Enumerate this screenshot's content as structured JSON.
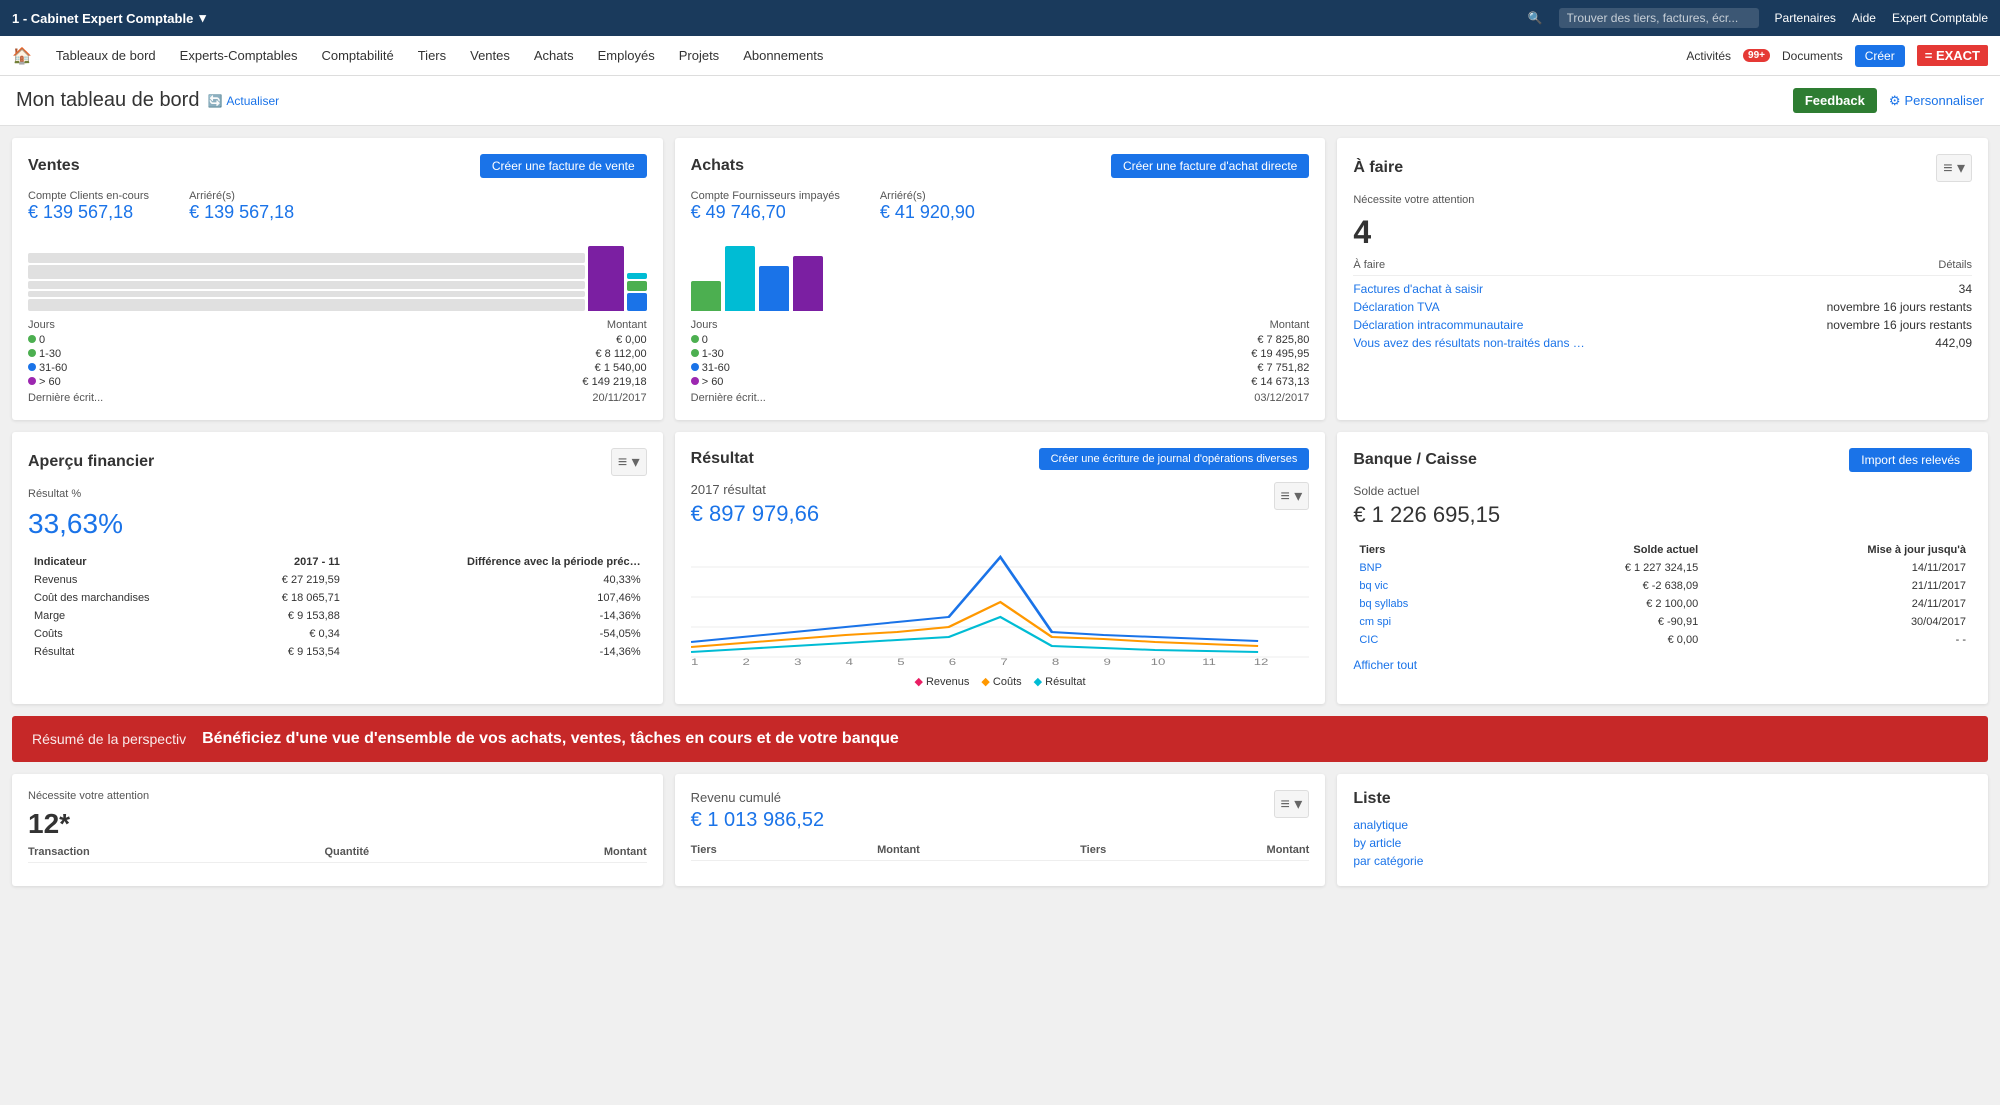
{
  "topbar": {
    "company": "1 - Cabinet Expert Comptable",
    "search_placeholder": "Trouver des tiers, factures, écr...",
    "partenaires": "Partenaires",
    "aide": "Aide",
    "expert_comptable": "Expert Comptable"
  },
  "navbar": {
    "items": [
      "Tableaux de bord",
      "Experts-Comptables",
      "Comptabilité",
      "Tiers",
      "Ventes",
      "Achats",
      "Employés",
      "Projets",
      "Abonnements"
    ],
    "activites": "Activités",
    "badge": "99+",
    "documents": "Documents",
    "creer": "Créer",
    "logo": "= EXACT"
  },
  "page": {
    "title": "Mon tableau de bord",
    "actualiser": "Actualiser",
    "feedback": "Feedback",
    "personaliser": "Personnaliser"
  },
  "ventes": {
    "title": "Ventes",
    "btn": "Créer une facture de vente",
    "compte_label": "Compte Clients en-cours",
    "compte_value": "€ 139 567,18",
    "arriere_label": "Arriéré(s)",
    "arriere_value": "€ 139 567,18",
    "legend": {
      "headers": [
        "Jours",
        "Montant"
      ],
      "rows": [
        {
          "dot_color": "#4caf50",
          "jours": "0",
          "montant": "€ 0,00"
        },
        {
          "dot_color": "#4caf50",
          "jours": "1-30",
          "montant": "€ 8 112,00"
        },
        {
          "dot_color": "#1a73e8",
          "jours": "31-60",
          "montant": "€ 1 540,00"
        },
        {
          "dot_color": "#9c27b0",
          "jours": "> 60",
          "montant": "€ 149 219,18"
        }
      ],
      "derniere": "Dernière écrit...",
      "derniere_val": "20/11/2017"
    }
  },
  "achats": {
    "title": "Achats",
    "btn": "Créer une facture d'achat directe",
    "compte_label": "Compte Fournisseurs impayés",
    "compte_value": "€ 49 746,70",
    "arriere_label": "Arriéré(s)",
    "arriere_value": "€ 41 920,90",
    "legend": {
      "headers": [
        "Jours",
        "Montant"
      ],
      "rows": [
        {
          "dot_color": "#4caf50",
          "jours": "0",
          "montant": "€ 7 825,80"
        },
        {
          "dot_color": "#4caf50",
          "jours": "1-30",
          "montant": "€ 19 495,95"
        },
        {
          "dot_color": "#1a73e8",
          "jours": "31-60",
          "montant": "€ 7 751,82"
        },
        {
          "dot_color": "#9c27b0",
          "jours": "> 60",
          "montant": "€ 14 673,13"
        }
      ],
      "derniere": "Dernière écrit...",
      "derniere_val": "03/12/2017"
    }
  },
  "afaire": {
    "title": "À faire",
    "attention_label": "Nécessite votre attention",
    "number": "4",
    "col1": "À faire",
    "col2": "Détails",
    "rows": [
      {
        "label": "Factures d'achat à saisir",
        "detail": "34",
        "detail_type": "number"
      },
      {
        "label": "Déclaration TVA",
        "detail": "novembre 16 jours restants",
        "detail_type": "text"
      },
      {
        "label": "Déclaration intracommunautaire",
        "detail": "novembre 16 jours restants",
        "detail_type": "text"
      },
      {
        "label": "Vous avez des résultats non-traités dans …",
        "detail": "442,09",
        "detail_type": "number"
      }
    ]
  },
  "apercu": {
    "title": "Aperçu financier",
    "resultat_label": "Résultat %",
    "resultat_value": "33,63%",
    "table_headers": [
      "Indicateur",
      "2017 - 11",
      "Différence avec la période préc…"
    ],
    "rows": [
      {
        "label": "Revenus",
        "val1": "€ 27 219,59",
        "val2": "40,33%"
      },
      {
        "label": "Coût des marchandises",
        "val1": "€ 18 065,71",
        "val2": "107,46%"
      },
      {
        "label": "Marge",
        "val1": "€ 9 153,88",
        "val2": "-14,36%"
      },
      {
        "label": "Coûts",
        "val1": "€ 0,34",
        "val2": "-54,05%"
      },
      {
        "label": "Résultat",
        "val1": "€ 9 153,54",
        "val2": "-14,36%"
      }
    ]
  },
  "resultat": {
    "title": "Résultat",
    "btn": "Créer une écriture de journal d'opérations diverses",
    "year_label": "2017 résultat",
    "value": "€ 897 979,66",
    "legend": {
      "revenus": "Revenus",
      "couts": "Coûts",
      "resultat": "Résultat"
    },
    "chart": {
      "labels": [
        "1",
        "2",
        "3",
        "4",
        "5",
        "6",
        "7",
        "8",
        "9",
        "10",
        "11",
        "12"
      ],
      "revenus": [
        20,
        25,
        30,
        35,
        40,
        45,
        90,
        30,
        25,
        20,
        18,
        15
      ],
      "couts": [
        15,
        18,
        20,
        22,
        25,
        30,
        40,
        20,
        18,
        15,
        12,
        10
      ],
      "res": [
        5,
        7,
        10,
        13,
        15,
        15,
        50,
        10,
        7,
        5,
        6,
        5
      ]
    }
  },
  "banque": {
    "title": "Banque / Caisse",
    "btn": "Import des relevés",
    "solde_label": "Solde actuel",
    "solde_value": "€ 1 226 695,15",
    "col1": "Tiers",
    "col2": "Solde actuel",
    "col3": "Mise à jour jusqu'à",
    "rows": [
      {
        "name": "BNP",
        "solde": "€ 1 227 324,15",
        "date": "14/11/2017"
      },
      {
        "name": "bq vic",
        "solde": "€ -2 638,09",
        "date": "21/11/2017"
      },
      {
        "name": "bq syllabs",
        "solde": "€ 2 100,00",
        "date": "24/11/2017"
      },
      {
        "name": "cm spi",
        "solde": "€ -90,91",
        "date": "30/04/2017"
      },
      {
        "name": "CIC",
        "solde": "€ 0,00",
        "date": "- -"
      }
    ],
    "afficher": "Afficher tout"
  },
  "banner": {
    "label": "Résumé de la perspectiv",
    "text": "Bénéficiez d'une vue d'ensemble de vos achats, ventes, tâches en cours et de votre banque"
  },
  "bottom": {
    "attention": {
      "label": "Nécessite votre attention",
      "number": "12*",
      "col1": "Transaction",
      "col2": "Quantité",
      "col3": "Montant"
    },
    "revenu": {
      "label": "Revenu cumulé",
      "value": "€ 1 013 986,52",
      "col1": "Tiers",
      "col2": "Montant",
      "col3": "Tiers",
      "col4": "Montant"
    },
    "liste": {
      "title": "Liste",
      "links": [
        "analytique",
        "by article",
        "par catégorie"
      ]
    }
  }
}
